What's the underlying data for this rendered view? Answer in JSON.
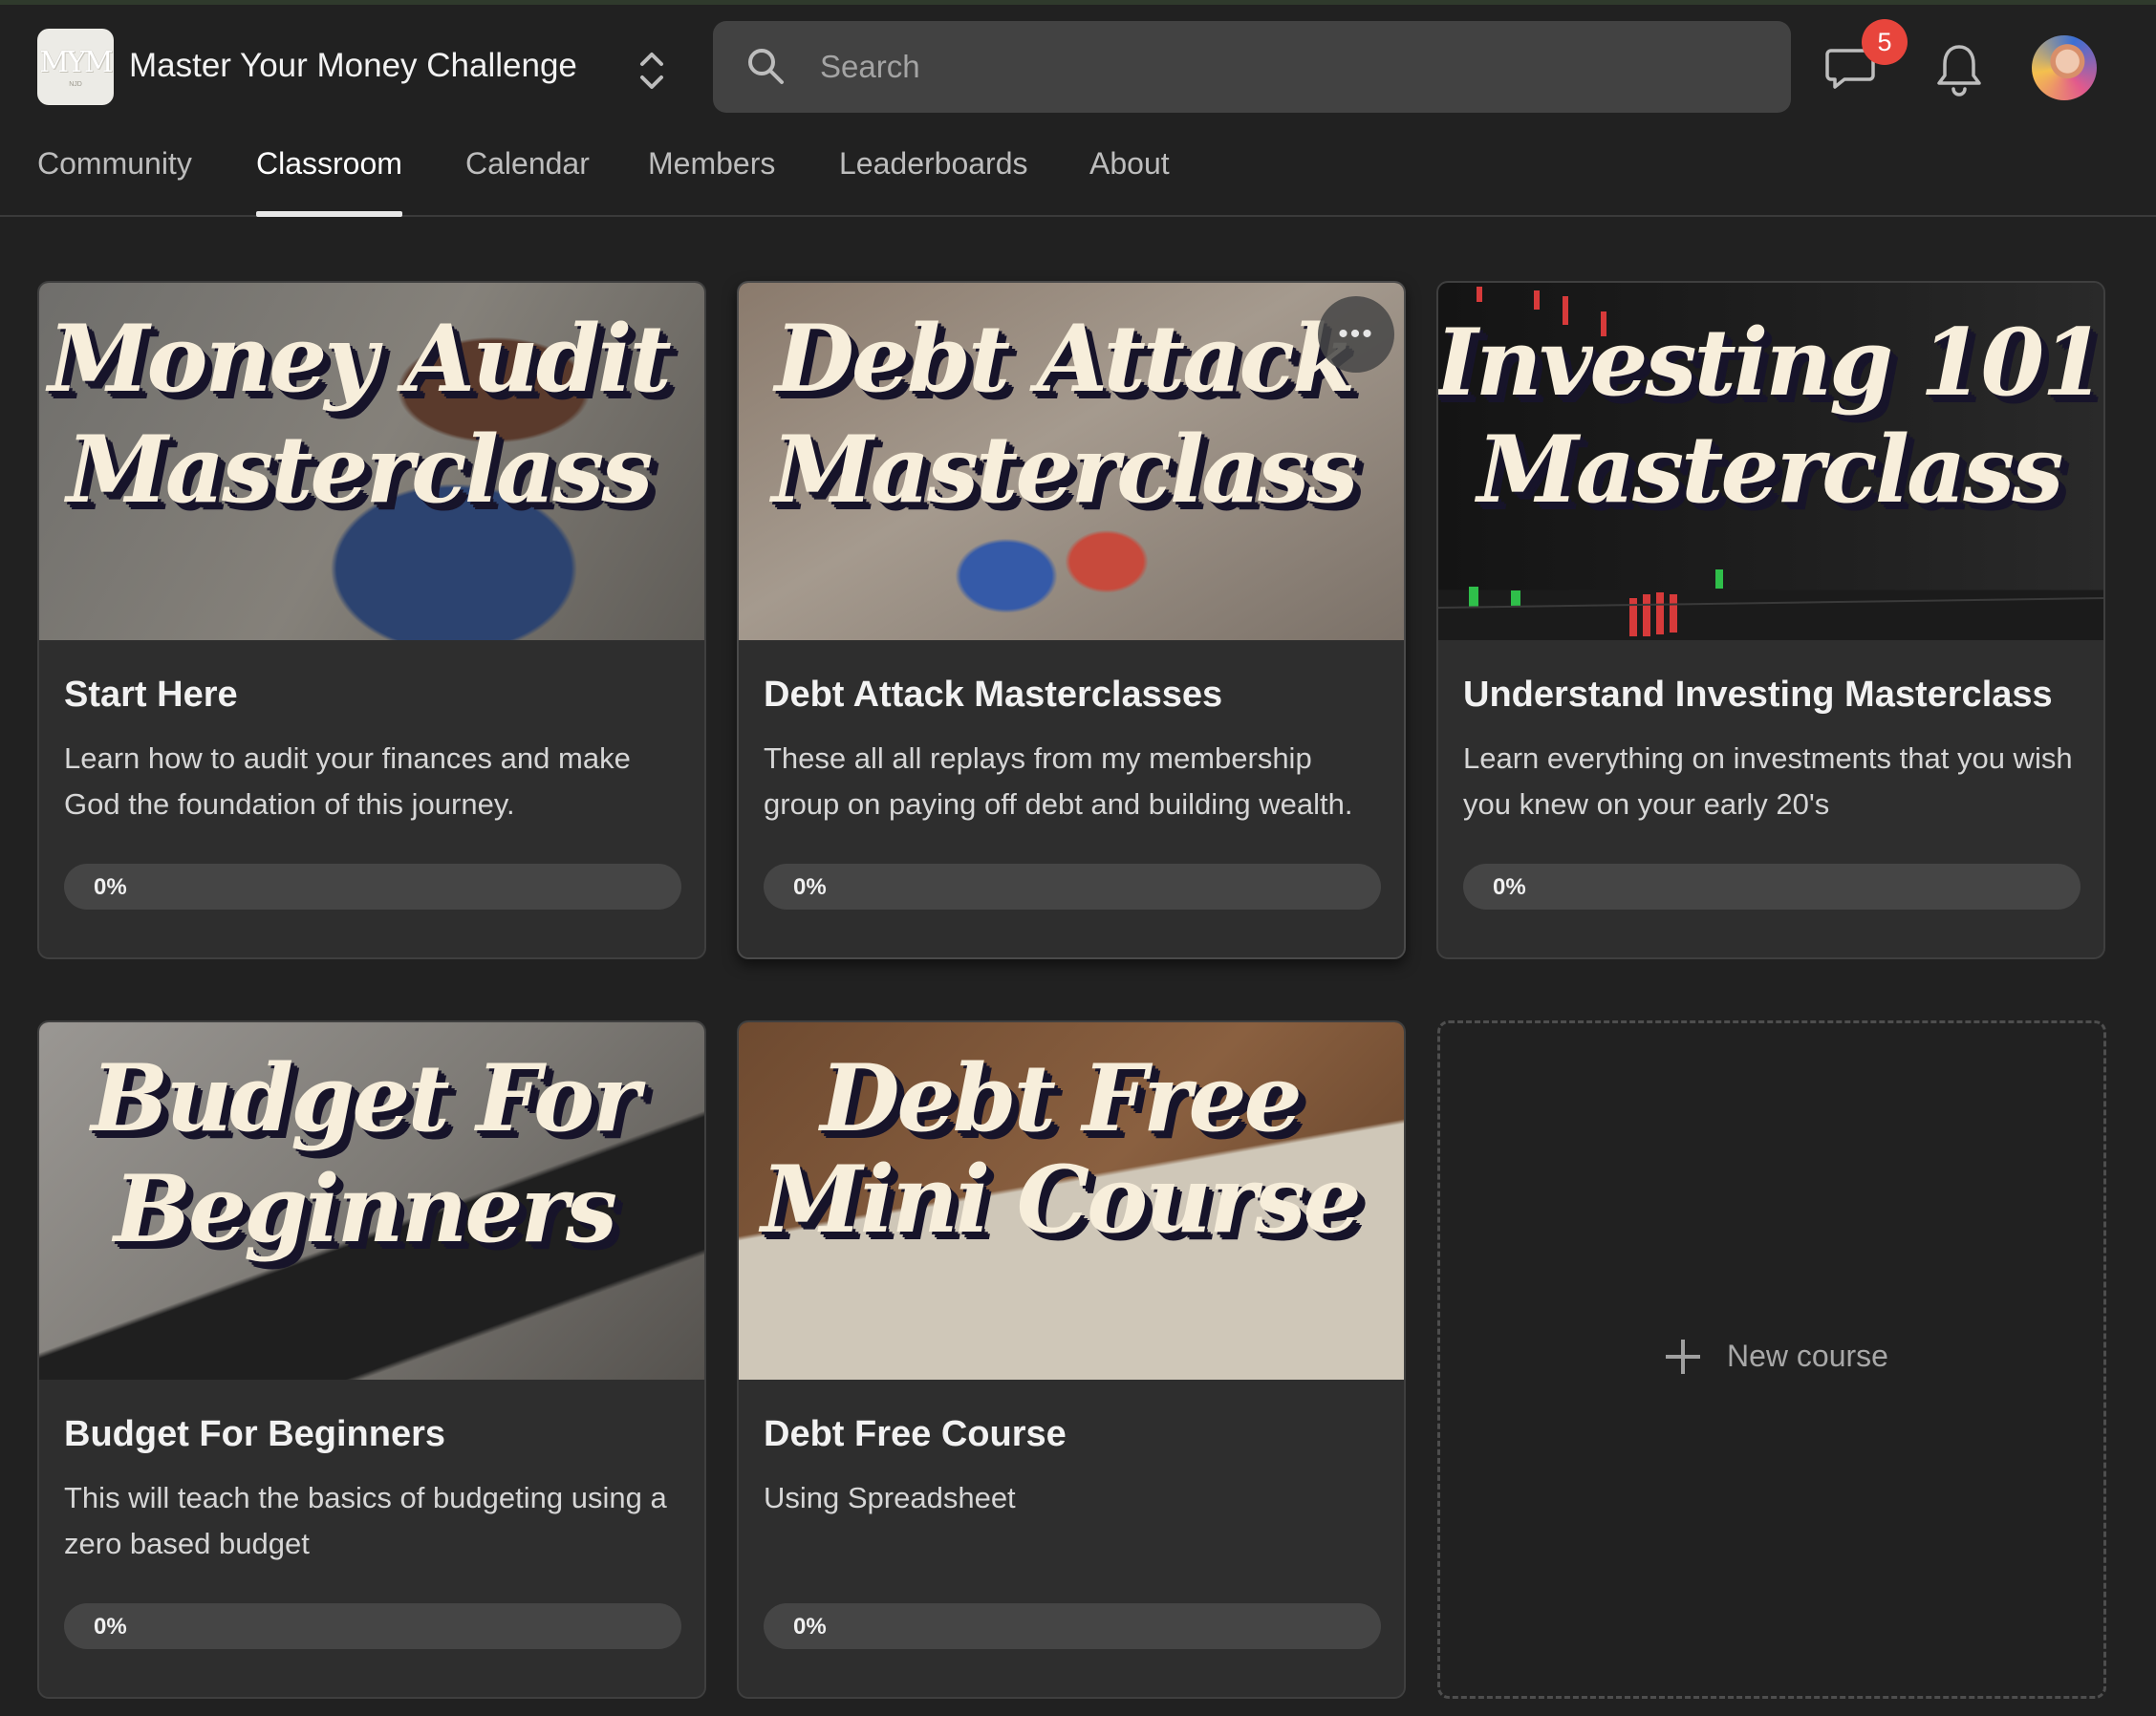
{
  "header": {
    "logo_text": "MYM",
    "logo_subtext": "NJD",
    "group_title": "Master Your Money Challenge",
    "search_placeholder": "Search",
    "chat_badge_count": "5",
    "icons": {
      "switcher": "chevron-up-down-icon",
      "search": "search-icon",
      "chat": "chat-bubble-icon",
      "notifications": "bell-icon"
    }
  },
  "tabs": [
    {
      "label": "Community",
      "active": false
    },
    {
      "label": "Classroom",
      "active": true
    },
    {
      "label": "Calendar",
      "active": false
    },
    {
      "label": "Members",
      "active": false
    },
    {
      "label": "Leaderboards",
      "active": false
    },
    {
      "label": "About",
      "active": false
    }
  ],
  "courses": [
    {
      "thumb_lines": [
        "Money Audit",
        "Masterclass"
      ],
      "title": "Start Here",
      "description": "Learn how to audit your finances and make God the foundation of this journey.",
      "progress_label": "0%",
      "progress": 0
    },
    {
      "thumb_lines": [
        "Debt Attack",
        "Masterclass"
      ],
      "title": "Debt Attack Masterclasses",
      "description": "These all all replays from my membership group on paying off debt and building wealth.",
      "progress_label": "0%",
      "progress": 0,
      "menu_label": "•••"
    },
    {
      "thumb_lines": [
        "Investing 101",
        "Masterclass"
      ],
      "title": "Understand Investing Masterclass",
      "description": "Learn everything on investments that you wish you knew on your early 20's",
      "progress_label": "0%",
      "progress": 0
    },
    {
      "thumb_lines": [
        "Budget For",
        "Beginners"
      ],
      "title": "Budget For Beginners",
      "description": "This will teach the basics of budgeting using a zero based budget",
      "progress_label": "0%",
      "progress": 0
    },
    {
      "thumb_lines": [
        "Debt Free",
        "Mini Course"
      ],
      "title": "Debt Free Course",
      "description": "Using Spreadsheet",
      "progress_label": "0%",
      "progress": 0
    }
  ],
  "new_course_label": "New course",
  "colors": {
    "background": "#212121",
    "card": "#2e2e2e",
    "badge": "#e8453c",
    "thumb_text": "#f7eedb",
    "thumb_text_shadow": "#17142a"
  }
}
